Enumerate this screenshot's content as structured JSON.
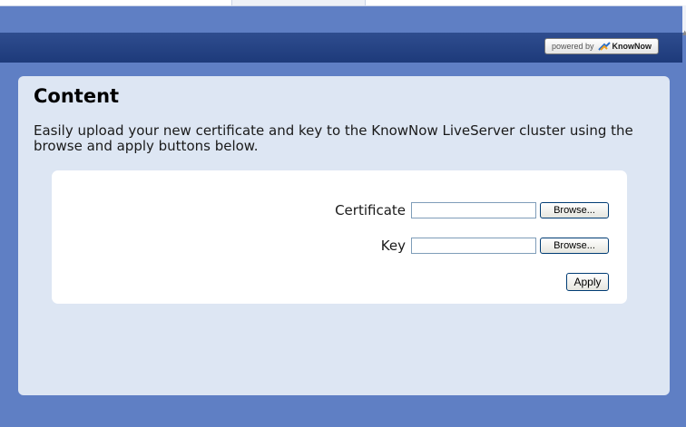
{
  "header": {
    "powered_prefix": "powered by",
    "powered_brand": "KnowNow"
  },
  "content": {
    "title": "Content",
    "intro": "Easily upload your new certificate and key to the KnowNow LiveServer cluster using the browse and apply buttons below."
  },
  "form": {
    "certificate_label": "Certificate",
    "certificate_value": "",
    "key_label": "Key",
    "key_value": "",
    "browse_label": "Browse...",
    "apply_label": "Apply"
  },
  "colors": {
    "page_background": "#5f7fc4",
    "header_band": "#1d3a7a",
    "panel": "#dde6f3",
    "card": "#ffffff"
  },
  "icons": {
    "brand_icon": "knownow-logo-icon",
    "scroll": "scroll-up-arrow-icon"
  }
}
